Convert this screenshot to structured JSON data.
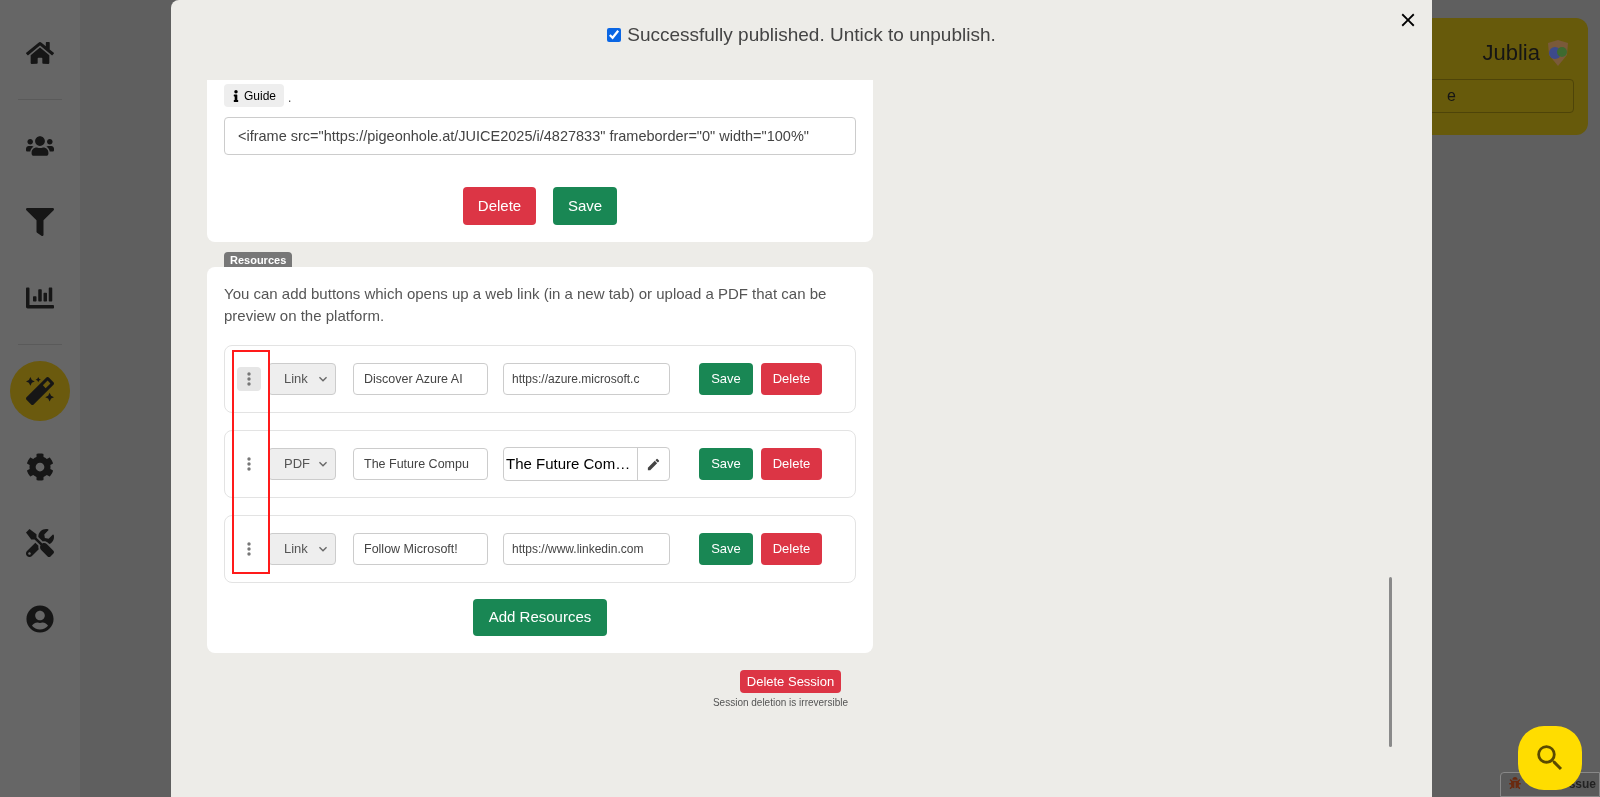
{
  "sidebar": {
    "items": [
      {
        "kind": "home",
        "selected": false
      },
      {
        "kind": "people",
        "selected": false
      },
      {
        "kind": "filter",
        "selected": false
      },
      {
        "kind": "chart",
        "selected": false
      },
      {
        "kind": "wand",
        "selected": true
      },
      {
        "kind": "gear",
        "selected": false
      },
      {
        "kind": "tools",
        "selected": false
      },
      {
        "kind": "account",
        "selected": false
      }
    ]
  },
  "header": {
    "logo": "Jublia",
    "field": {
      "value": "e"
    }
  },
  "modal": {
    "publish": {
      "checked": true,
      "label": "Successfully published. Untick to unpublish."
    },
    "embed": {
      "guide_button": "Guide",
      "trailing": ".",
      "code": "<iframe src=\"https://pigeonhole.at/JUICE2025/i/4827833\" frameborder=\"0\" width=\"100%\"",
      "delete": "Delete",
      "save": "Save"
    },
    "resources": {
      "badge": "Resources",
      "description": "You can add buttons which opens up a web link (in a new tab) or upload a PDF that can be preview on the platform.",
      "items": [
        {
          "kind": "link",
          "highlighted": true,
          "type": "Link",
          "name": "Discover Azure AI",
          "target": "https://azure.microsoft.c",
          "save": "Save",
          "delete": "Delete"
        },
        {
          "kind": "pdf",
          "highlighted": false,
          "type": "PDF",
          "name": "The Future Compu",
          "target": "The Future Com…",
          "save": "Save",
          "delete": "Delete"
        },
        {
          "kind": "link",
          "highlighted": false,
          "type": "Link",
          "name": "Follow Microsoft!",
          "target": "https://www.linkedin.com",
          "save": "Save",
          "delete": "Delete"
        }
      ],
      "add": "Add Resources"
    },
    "delete_session": {
      "button": "Delete Session",
      "note": "Session deletion is irreversible"
    }
  },
  "report": {
    "label": "ssue"
  }
}
